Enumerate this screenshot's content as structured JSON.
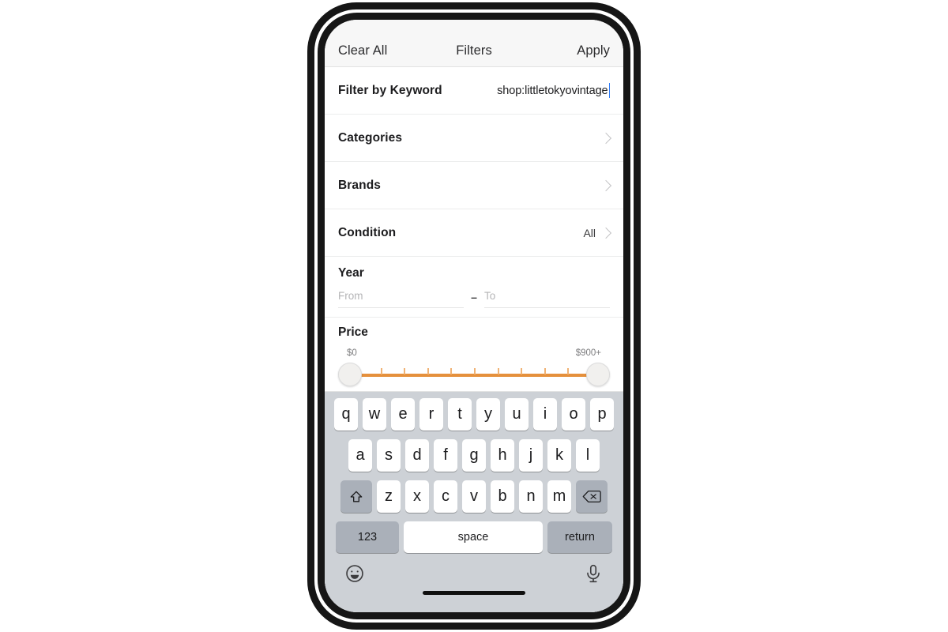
{
  "nav": {
    "clear_all": "Clear All",
    "title": "Filters",
    "apply": "Apply"
  },
  "filters": {
    "keyword": {
      "label": "Filter by Keyword",
      "value": "shop:littletokyovintage"
    },
    "categories": {
      "label": "Categories",
      "chevron": "chevron-right-icon"
    },
    "brands": {
      "label": "Brands",
      "chevron": "chevron-right-icon"
    },
    "condition": {
      "label": "Condition",
      "value": "All",
      "chevron": "chevron-right-icon"
    },
    "year": {
      "label": "Year",
      "from_placeholder": "From",
      "to_placeholder": "To",
      "separator": "–"
    },
    "price": {
      "label": "Price",
      "min_label": "$0",
      "max_label": "$900+",
      "tick_count": 11,
      "track_color": "#e5903c",
      "tick_color": "#f0b375"
    }
  },
  "keyboard": {
    "row1": [
      "q",
      "w",
      "e",
      "r",
      "t",
      "y",
      "u",
      "i",
      "o",
      "p"
    ],
    "row2": [
      "a",
      "s",
      "d",
      "f",
      "g",
      "h",
      "j",
      "k",
      "l"
    ],
    "row3": [
      "z",
      "x",
      "c",
      "v",
      "b",
      "n",
      "m"
    ],
    "shift": "shift-icon",
    "backspace": "backspace-icon",
    "numbers_label": "123",
    "space_label": "space",
    "return_label": "return",
    "emoji": "emoji-icon",
    "mic": "microphone-icon"
  },
  "colors": {
    "cursor": "#2f7bf6",
    "keyboard_bg": "#cdd1d6",
    "key_bg": "#ffffff",
    "key_dark_bg": "#aab0b9",
    "nav_bg": "#f7f7f7"
  }
}
